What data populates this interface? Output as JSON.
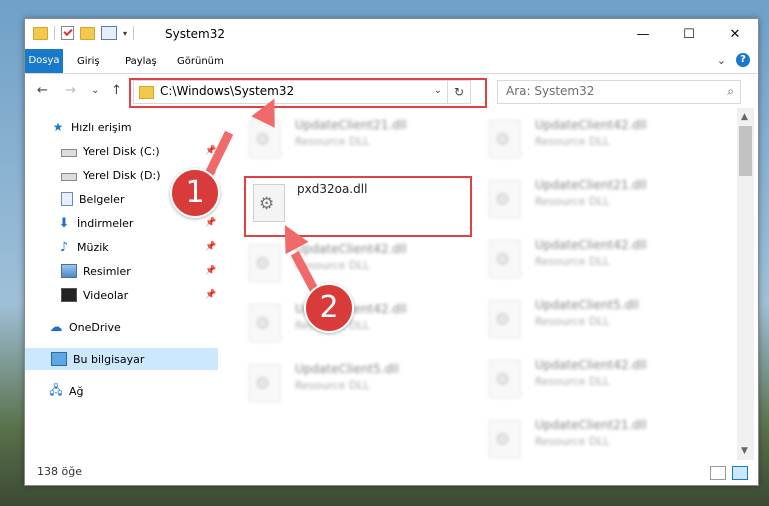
{
  "window": {
    "title": "System32"
  },
  "titlebar": {
    "minimize": "—",
    "maximize": "☐",
    "close": "✕"
  },
  "ribbon": {
    "tabs": [
      "Dosya",
      "Giriş",
      "Paylaş",
      "Görünüm"
    ],
    "expand": "⌄",
    "help": "?"
  },
  "nav": {
    "back": "←",
    "forward": "→",
    "recent": "⌄",
    "up": "↑"
  },
  "address": {
    "path": "C:\\Windows\\System32",
    "dropdown": "⌄",
    "refresh": "↻"
  },
  "search": {
    "placeholder": "Ara: System32",
    "icon": "⌕"
  },
  "sidebar": {
    "items": [
      {
        "label": "Hızlı erişim",
        "icon": "star-icon",
        "pinned": false
      },
      {
        "label": "Yerel Disk (C:)",
        "icon": "drive-icon",
        "pinned": true
      },
      {
        "label": "Yerel Disk (D:)",
        "icon": "drive-icon",
        "pinned": true
      },
      {
        "label": "Belgeler",
        "icon": "documents-icon",
        "pinned": true
      },
      {
        "label": "İndirmeler",
        "icon": "download-icon",
        "pinned": true
      },
      {
        "label": "Müzik",
        "icon": "music-icon",
        "pinned": true
      },
      {
        "label": "Resimler",
        "icon": "pictures-icon",
        "pinned": true
      },
      {
        "label": "Videolar",
        "icon": "video-icon",
        "pinned": true
      },
      {
        "label": "OneDrive",
        "icon": "cloud-icon",
        "pinned": false
      },
      {
        "label": "Bu bilgisayar",
        "icon": "computer-icon",
        "pinned": false,
        "selected": true
      },
      {
        "label": "Ağ",
        "icon": "network-icon",
        "pinned": false
      }
    ],
    "pin_glyph": "📌"
  },
  "files": {
    "focused": {
      "name": "pxd32oa.dll"
    },
    "left_column": [
      {
        "name": "UpdateClient21.dll",
        "type": "Resource DLL"
      },
      {
        "name": "UpdateClient42.dll",
        "type": "Resource DLL"
      },
      {
        "name": "UpdateClient42.dll",
        "type": "Resource DLL"
      },
      {
        "name": "UpdateClient5.dll",
        "type": "Resource DLL"
      }
    ],
    "right_column": [
      {
        "name": "UpdateClient42.dll",
        "type": "Resource DLL"
      },
      {
        "name": "UpdateClient21.dll",
        "type": "Resource DLL"
      },
      {
        "name": "UpdateClient42.dll",
        "type": "Resource DLL"
      },
      {
        "name": "UpdateClient5.dll",
        "type": "Resource DLL"
      },
      {
        "name": "UpdateClient42.dll",
        "type": "Resource DLL"
      },
      {
        "name": "UpdateClient21.dll",
        "type": "Resource DLL"
      }
    ]
  },
  "scrollbar": {
    "up": "▲",
    "down": "▼"
  },
  "status": {
    "item_count": "138 öğe"
  },
  "annotations": {
    "badge1": "1",
    "badge2": "2"
  },
  "colors": {
    "accent": "#1979ca",
    "highlight": "#e04141",
    "selected": "#cce8ff"
  }
}
